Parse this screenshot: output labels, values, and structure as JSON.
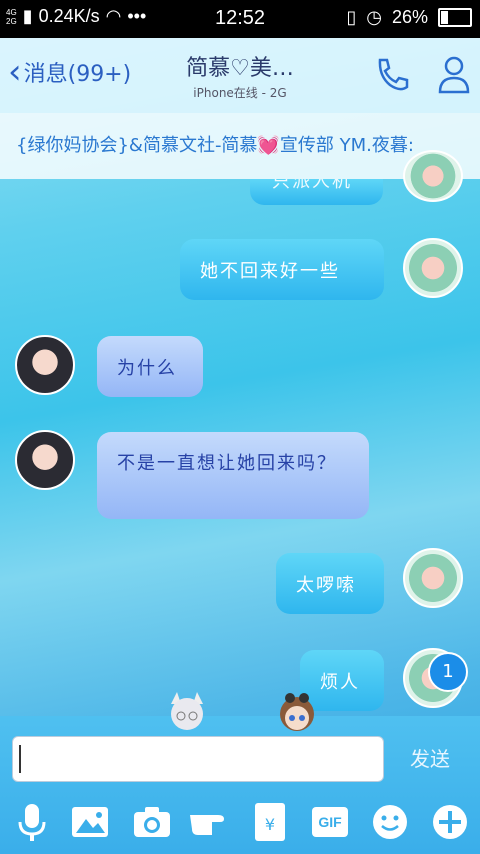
{
  "status_bar": {
    "network": "4G\n2G",
    "speed": "0.24K/s",
    "dots": "•••",
    "time": "12:52",
    "battery": "26%",
    "battery_level": 0.26
  },
  "header": {
    "back_label": "消息(99+)",
    "title": "简慕♡美…",
    "subtitle": "iPhone在线 - 2G"
  },
  "group_banner": "{绿你妈协会}&简慕文社-简慕💓宣传部   YM.夜暮:",
  "messages": [
    {
      "side": "out",
      "text": "只派人机",
      "partial": true
    },
    {
      "side": "out",
      "text": "她不回来好一些"
    },
    {
      "side": "in",
      "text": "为什么"
    },
    {
      "side": "in",
      "text": "不是一直想让她回来吗？"
    },
    {
      "side": "out",
      "text": "太啰嗦"
    },
    {
      "side": "out",
      "text": "烦人"
    }
  ],
  "unread_badge": "1",
  "input": {
    "placeholder": ""
  },
  "send_label": "发送",
  "toolbar": [
    {
      "name": "mic-icon"
    },
    {
      "name": "image-icon"
    },
    {
      "name": "camera-icon"
    },
    {
      "name": "poke-icon"
    },
    {
      "name": "red-packet-icon",
      "text": "¥"
    },
    {
      "name": "gif-icon",
      "text": "GIF"
    },
    {
      "name": "emoji-icon"
    },
    {
      "name": "plus-icon"
    }
  ],
  "colors": {
    "accent": "#2b5fc1",
    "bubble_out": "#3cbcf0",
    "bubble_in": "#a9c5f8"
  }
}
